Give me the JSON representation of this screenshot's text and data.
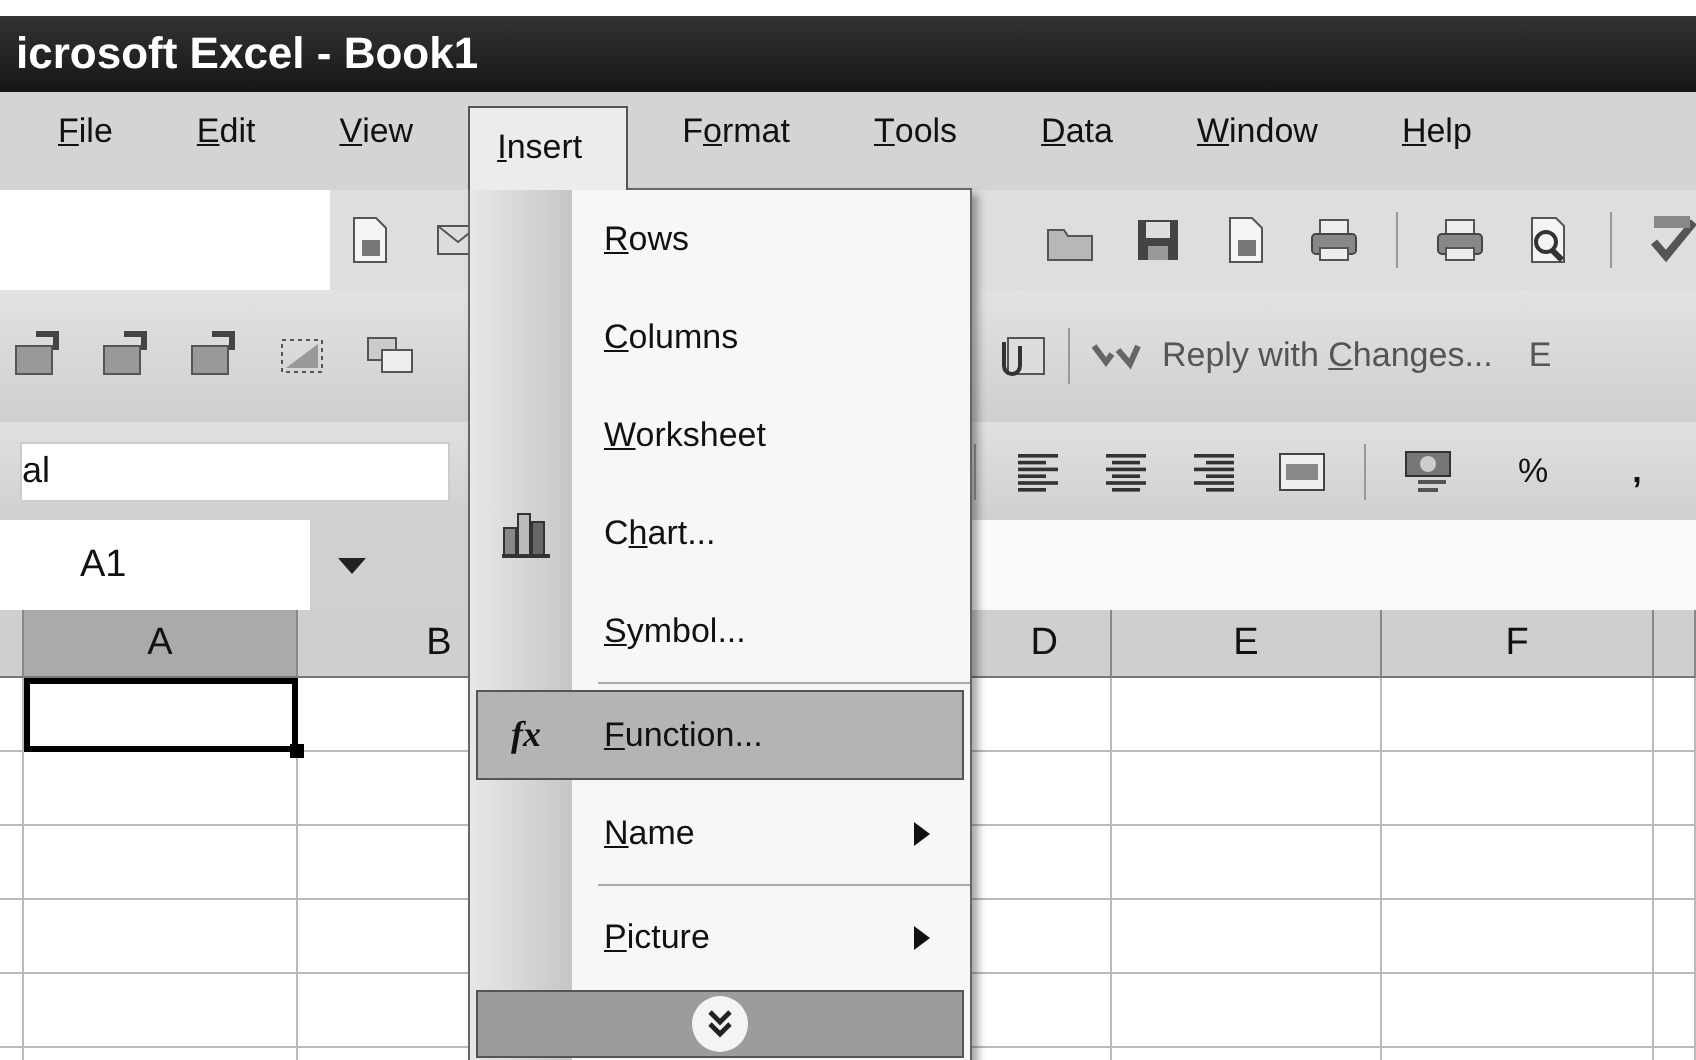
{
  "window": {
    "title": "icrosoft Excel - Book1"
  },
  "menu_bar": [
    {
      "label": {
        "key": "F",
        "post": "ile"
      },
      "selected": false
    },
    {
      "label": {
        "key": "E",
        "post": "dit"
      },
      "selected": false
    },
    {
      "label": {
        "key": "V",
        "post": "iew"
      },
      "selected": false
    },
    {
      "label": {
        "key": "I",
        "post": "nsert"
      },
      "selected": true
    },
    {
      "label": {
        "pre": "F",
        "key": "o",
        "post": "rmat"
      },
      "selected": false
    },
    {
      "label": {
        "key": "T",
        "post": "ools"
      },
      "selected": false
    },
    {
      "label": {
        "key": "D",
        "post": "ata"
      },
      "selected": false
    },
    {
      "label": {
        "key": "W",
        "post": "indow"
      },
      "selected": false
    },
    {
      "label": {
        "key": "H",
        "post": "elp"
      },
      "selected": false
    }
  ],
  "reviewing_toolbar": {
    "reply_button": {
      "pre": "Reply with ",
      "key": "C",
      "post": "hanges..."
    },
    "next_text": "E"
  },
  "formatting_toolbar": {
    "font_field": {
      "value": "al"
    },
    "percent_text": "%",
    "comma_text": ","
  },
  "name_box": {
    "value": "A1"
  },
  "grid": {
    "columns": [
      {
        "label": "A",
        "selected": true
      },
      {
        "label": "B",
        "selected": false
      },
      {
        "label": "D",
        "selected": false
      },
      {
        "label": "E",
        "selected": false
      },
      {
        "label": "F",
        "selected": false
      },
      {
        "selected": false
      }
    ]
  },
  "insert_menu": {
    "items": [
      {
        "label": {
          "key": "R",
          "post": "ows"
        },
        "kind": "plain",
        "submenu": false,
        "separator_before": false,
        "selected": false
      },
      {
        "label": {
          "key": "C",
          "post": "olumns"
        },
        "kind": "plain",
        "submenu": false,
        "separator_before": false,
        "selected": false
      },
      {
        "label": {
          "key": "W",
          "post": "orksheet"
        },
        "kind": "plain",
        "submenu": false,
        "separator_before": false,
        "selected": false
      },
      {
        "label": {
          "pre": "C",
          "key": "h",
          "post": "art..."
        },
        "kind": "chart",
        "submenu": false,
        "separator_before": false,
        "selected": false
      },
      {
        "label": {
          "key": "S",
          "post": "ymbol..."
        },
        "kind": "plain",
        "submenu": false,
        "separator_before": false,
        "selected": false
      },
      {
        "label": {
          "key": "F",
          "post": "unction..."
        },
        "kind": "function",
        "icon_text": "fx",
        "submenu": false,
        "separator_before": true,
        "selected": true
      },
      {
        "label": {
          "key": "N",
          "post": "ame"
        },
        "kind": "plain",
        "submenu": true,
        "separator_before": false,
        "selected": false
      },
      {
        "label": {
          "key": "P",
          "post": "icture"
        },
        "kind": "plain",
        "submenu": true,
        "separator_before": true,
        "selected": false
      }
    ]
  }
}
